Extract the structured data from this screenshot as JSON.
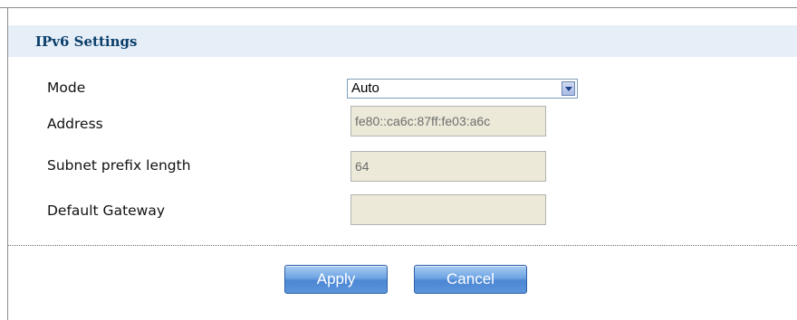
{
  "section": {
    "title": "IPv6 Settings"
  },
  "fields": {
    "mode": {
      "label": "Mode",
      "value": "Auto"
    },
    "address": {
      "label": "Address",
      "value": "fe80::ca6c:87ff:fe03:a6c"
    },
    "prefix": {
      "label": "Subnet prefix length",
      "value": "64"
    },
    "gateway": {
      "label": "Default Gateway",
      "value": ""
    }
  },
  "buttons": {
    "apply": "Apply",
    "cancel": "Cancel"
  }
}
